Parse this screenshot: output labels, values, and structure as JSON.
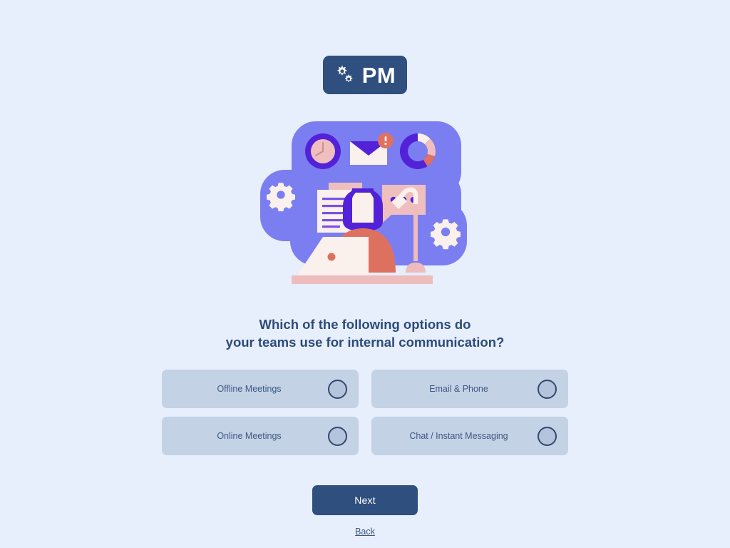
{
  "background_color": "#e7eefc",
  "logo": {
    "text": "PM",
    "icon": "gears-icon",
    "background_color": "#2f4f7f",
    "text_color": "#ffffff"
  },
  "illustration": {
    "name": "workspace-productivity-illustration",
    "blob_color": "#7b7ef0",
    "elements": [
      "clock-icon",
      "envelope-icon",
      "alert-badge-icon",
      "donut-chart-icon",
      "documents-icon",
      "chat-bubble-icon",
      "gear-icon-left",
      "gear-icon-right",
      "person-at-laptop",
      "desk-lamp"
    ],
    "colors": {
      "purple": "#5322d8",
      "light_purple": "#7b7ef0",
      "cream": "#faf0ec",
      "pink": "#eebfbe",
      "coral": "#e0705f",
      "desk": "#efbcbd"
    }
  },
  "question": {
    "line1": "Which of the following options do",
    "line2": "your teams use for internal communication?",
    "text_color": "#2d4b78"
  },
  "options": {
    "items": [
      {
        "label": "Offline Meetings",
        "selected": false
      },
      {
        "label": "Email & Phone",
        "selected": false
      },
      {
        "label": "Online Meetings",
        "selected": false
      },
      {
        "label": "Chat / Instant Messaging",
        "selected": false
      }
    ],
    "background_color": "#c4d2e6",
    "label_color": "#3c5a80"
  },
  "footer": {
    "next_label": "Next",
    "back_label": "Back",
    "next_button_color": "#2f4f7f"
  }
}
